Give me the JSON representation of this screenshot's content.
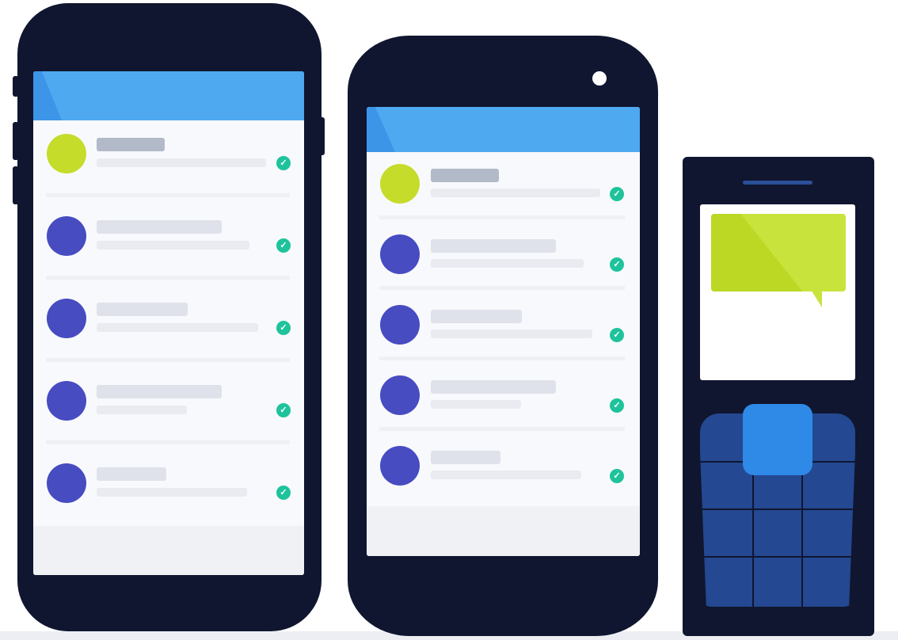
{
  "illustration": {
    "phones": [
      {
        "kind": "smartphone-ios",
        "rows": [
          {
            "avatar_color": "green",
            "status": "delivered"
          },
          {
            "avatar_color": "blue",
            "status": "delivered"
          },
          {
            "avatar_color": "blue",
            "status": "delivered"
          },
          {
            "avatar_color": "blue",
            "status": "delivered"
          },
          {
            "avatar_color": "blue",
            "status": "delivered"
          }
        ]
      },
      {
        "kind": "smartphone-android",
        "rows": [
          {
            "avatar_color": "green",
            "status": "delivered"
          },
          {
            "avatar_color": "blue",
            "status": "delivered"
          },
          {
            "avatar_color": "blue",
            "status": "delivered"
          },
          {
            "avatar_color": "blue",
            "status": "delivered"
          },
          {
            "avatar_color": "blue",
            "status": "delivered"
          }
        ]
      },
      {
        "kind": "feature-phone",
        "screen": "message-bubble",
        "keypad": "3x3"
      }
    ],
    "check_glyph": "✓",
    "colors": {
      "device_body": "#10162f",
      "header_blue": "#4ea9f0",
      "avatar_green": "#c5dc2b",
      "avatar_blue": "#474cc1",
      "check_teal": "#1ec39b",
      "bubble_lime": "#c8e43c",
      "keypad_blue": "#244891",
      "nav_key_blue": "#2f89e6"
    }
  }
}
